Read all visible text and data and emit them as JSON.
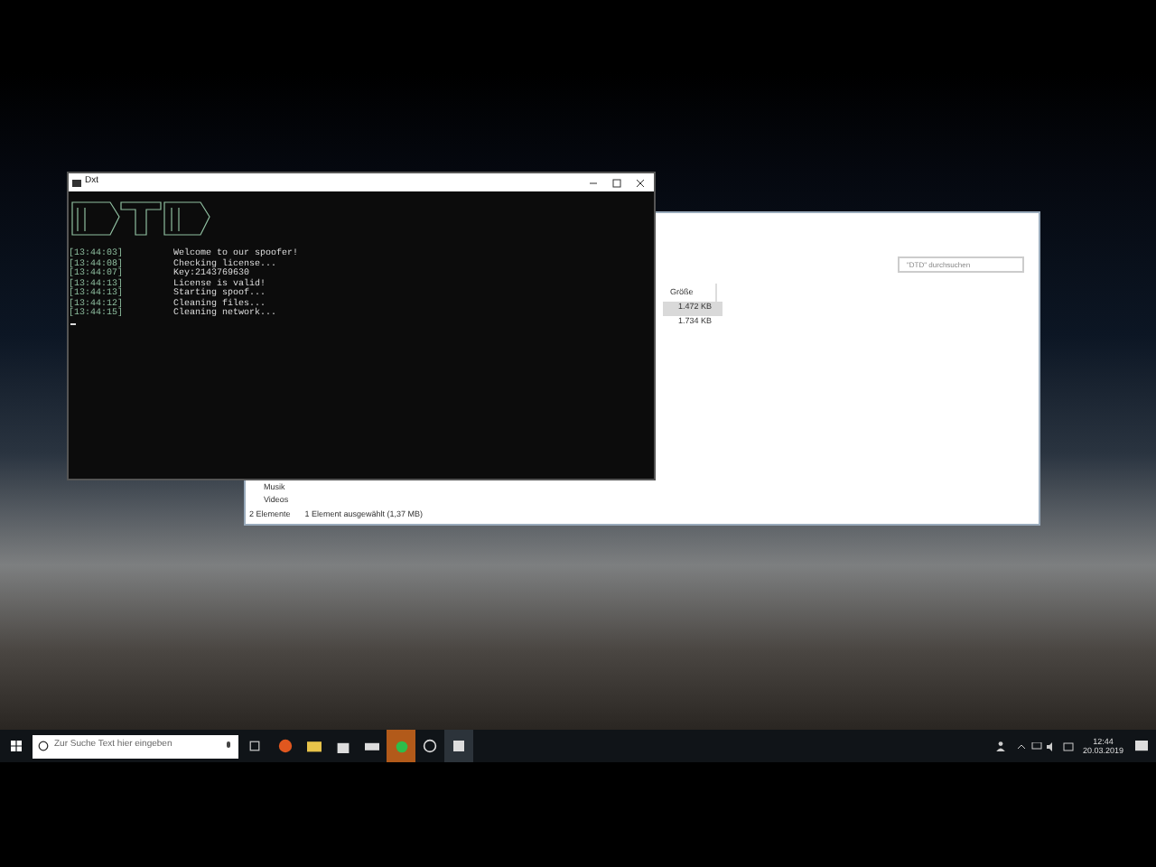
{
  "console_window": {
    "title": "Dxt",
    "lines": [
      {
        "time": "[13:44:03]",
        "message": "Welcome to our spoofer!"
      },
      {
        "time": "[13:44:08]",
        "message": "Checking license..."
      },
      {
        "time": "[13:44:07]",
        "message": "Key:2143769630"
      },
      {
        "time": "[13:44:13]",
        "message": "License is valid!"
      },
      {
        "time": "[13:44:13]",
        "message": "Starting spoof..."
      },
      {
        "time": "[13:44:12]",
        "message": "Cleaning files..."
      },
      {
        "time": "[13:44:15]",
        "message": "Cleaning network..."
      }
    ]
  },
  "explorer_window": {
    "search": {
      "placeholder": "\"DTD\" durchsuchen"
    },
    "column_header": "Größe",
    "rows": [
      {
        "size": "1.472 KB",
        "selected": true
      },
      {
        "size": "1.734 KB",
        "selected": false
      }
    ],
    "sidebar": [
      "Musik",
      "Videos"
    ],
    "status_bar": {
      "count": "2 Elemente",
      "selection": "1 Element ausgewählt (1,37 MB)"
    }
  },
  "taskbar": {
    "search": {
      "placeholder": "Zur Suche Text hier eingeben"
    },
    "time": "12:44",
    "date": "20.03.2019"
  }
}
